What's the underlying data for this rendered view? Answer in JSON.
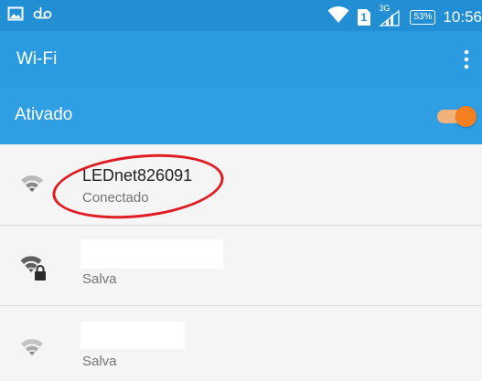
{
  "status_bar": {
    "time": "10:56",
    "battery": "53%",
    "network": "3G",
    "sim": "1",
    "left_icons": [
      "gallery-icon",
      "voicemail-icon"
    ],
    "right_icons": [
      "wifi-icon",
      "sim-icon",
      "signal-icon",
      "battery-icon"
    ]
  },
  "app_bar": {
    "title": "Wi-Fi",
    "menu_icon": "overflow-menu-icon"
  },
  "toggle": {
    "label": "Ativado",
    "state": "on",
    "accent": "#f47f1e"
  },
  "networks": [
    {
      "name": "LEDnet826091",
      "status": "Conectado",
      "secured": false,
      "highlighted": true
    },
    {
      "name": "",
      "status": "Salva",
      "secured": true,
      "highlighted": false
    },
    {
      "name": "",
      "status": "Salva",
      "secured": false,
      "highlighted": false
    }
  ],
  "colors": {
    "status_bar": "#228ed4",
    "app_bar": "#2a9be1",
    "toggle_row": "#2f9ee3",
    "annotation": "#e01b22"
  }
}
